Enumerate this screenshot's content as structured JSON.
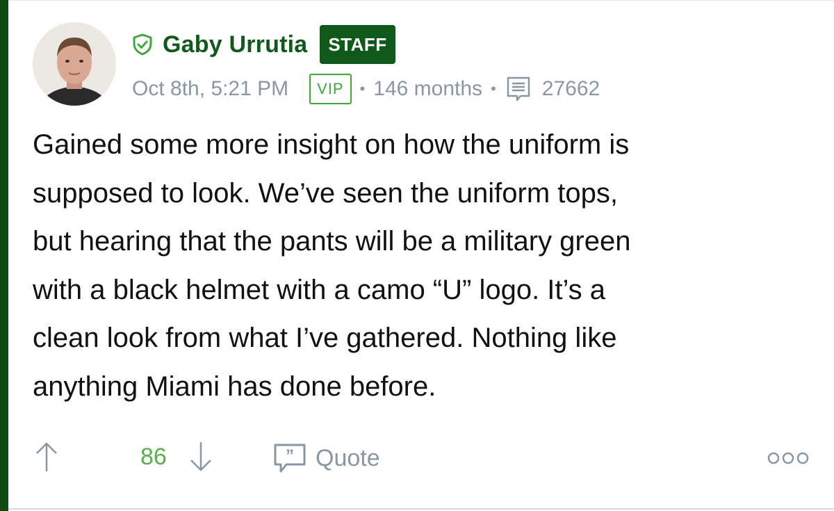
{
  "author": {
    "name": "Gaby Urrutia",
    "staff_badge": "STAFF",
    "avatar_icon": "user-avatar"
  },
  "meta": {
    "timestamp": "Oct 8th, 5:21 PM",
    "vip_badge": "VIP",
    "tenure": "146 months",
    "post_count": "27662"
  },
  "post": {
    "lines": [
      "Gained some more insight on how the uniform is",
      "supposed to look. We’ve seen the uniform tops,",
      "but hearing that the pants will be a military green",
      "with a black helmet with a camo “U” logo. It’s a",
      "clean look from what I’ve gathered. Nothing like",
      "anything Miami has done before."
    ]
  },
  "actions": {
    "vote_count": "86",
    "quote_label": "Quote"
  },
  "colors": {
    "accent_dark_green": "#0f5a1a",
    "vip_green": "#3ea83a",
    "vote_green": "#56b248",
    "meta_gray": "#8997a5",
    "text": "#111111"
  }
}
